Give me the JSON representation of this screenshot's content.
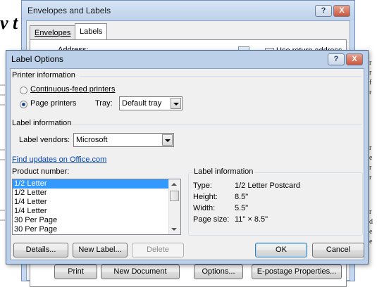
{
  "background": {
    "heading": "v t",
    "right_letters": [
      "r",
      "r",
      "f",
      "r",
      "r",
      "e",
      "r",
      "r",
      "r",
      "d",
      "e",
      "e"
    ]
  },
  "envelopes_window": {
    "title": "Envelopes and Labels",
    "help_glyph": "?",
    "close_glyph": "X",
    "tabs": [
      {
        "label": "Envelopes"
      },
      {
        "label": "Labels"
      }
    ],
    "address_label": "Address:",
    "use_return_address": "Use return address",
    "buttons": {
      "print": "Print",
      "new_document": "New Document",
      "options": "Options...",
      "epostage": "E-postage Properties..."
    }
  },
  "dialog": {
    "title": "Label Options",
    "help_glyph": "?",
    "close_glyph": "X",
    "printer_info": {
      "heading": "Printer information",
      "continuous": "Continuous-feed printers",
      "page_printers": "Page printers",
      "tray_label": "Tray:",
      "tray_value": "Default tray",
      "selected": "page_printers"
    },
    "label_info": {
      "heading": "Label information",
      "vendors_label": "Label vendors:",
      "vendors_value": "Microsoft",
      "find_updates": "Find updates on Office.com"
    },
    "product_number": {
      "label": "Product number:",
      "items": [
        "1/2 Letter",
        "1/2 Letter",
        "1/4 Letter",
        "1/4 Letter",
        "30 Per Page",
        "30 Per Page"
      ],
      "selected_index": 0
    },
    "details_panel": {
      "heading": "Label information",
      "rows": [
        {
          "key": "Type:",
          "value": "1/2 Letter Postcard"
        },
        {
          "key": "Height:",
          "value": "8.5\""
        },
        {
          "key": "Width:",
          "value": "5.5\""
        },
        {
          "key": "Page size:",
          "value": "11\" × 8.5\""
        }
      ]
    },
    "buttons": {
      "details": "Details...",
      "new_label": "New Label...",
      "delete": "Delete",
      "ok": "OK",
      "cancel": "Cancel"
    }
  },
  "colors": {
    "titlebar": "#bcd0ea",
    "selection": "#3399ff",
    "link": "#0645ad"
  }
}
